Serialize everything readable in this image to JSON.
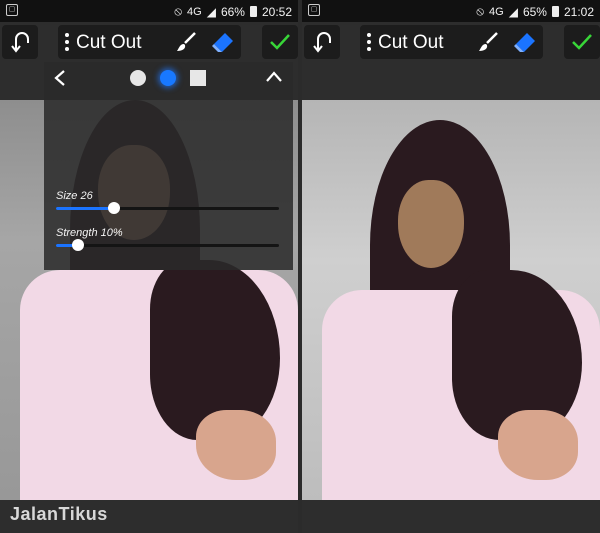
{
  "left": {
    "status": {
      "battery": "66%",
      "time": "20:52",
      "network": "4G"
    },
    "toolbar": {
      "title": "Cut Out"
    },
    "brush_panel": {
      "size": {
        "label": "Size 26",
        "value": 26,
        "max": 100
      },
      "strength": {
        "label": "Strength 10%",
        "value": 10,
        "max": 100
      },
      "selected_shape": "soft-round"
    }
  },
  "right": {
    "status": {
      "battery": "65%",
      "time": "21:02",
      "network": "4G"
    },
    "toolbar": {
      "title": "Cut Out"
    }
  },
  "watermark": "JalanTikus",
  "colors": {
    "accent": "#1b74ff",
    "confirm": "#38d638",
    "toolbar_bg": "#1c1c1c"
  },
  "icons": [
    "undo-icon",
    "menu-dots-icon",
    "brush-icon",
    "eraser-icon",
    "checkmark-icon",
    "chevron-left-icon",
    "chevron-up-icon"
  ]
}
